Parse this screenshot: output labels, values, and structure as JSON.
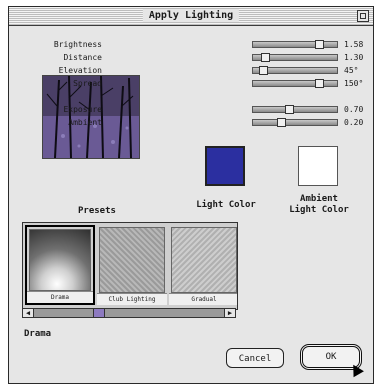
{
  "window": {
    "title": "Apply Lighting"
  },
  "sliders": [
    {
      "label": "Brightness",
      "value": "1.58",
      "level": 0.75
    },
    {
      "label": "Distance",
      "value": "1.30",
      "level": 0.12
    },
    {
      "label": "Elevation",
      "value": "45°",
      "level": 0.1
    },
    {
      "label": "Spread",
      "value": "150°",
      "level": 0.75
    },
    {
      "label": "Exposure",
      "value": "0.70",
      "level": 0.4
    },
    {
      "label": "Ambient",
      "value": "0.20",
      "level": 0.3
    }
  ],
  "colors": {
    "light_label": "Light Color",
    "light_color": "#2b2fa0",
    "ambient_label_1": "Ambient",
    "ambient_label_2": "Light Color",
    "ambient_color": "#ffffff"
  },
  "presets": {
    "label": "Presets",
    "items": [
      {
        "name": "Drama"
      },
      {
        "name": "Club Lighting"
      },
      {
        "name": "Gradual"
      }
    ],
    "selected": "Drama"
  },
  "buttons": {
    "cancel": "Cancel",
    "ok": "OK"
  }
}
